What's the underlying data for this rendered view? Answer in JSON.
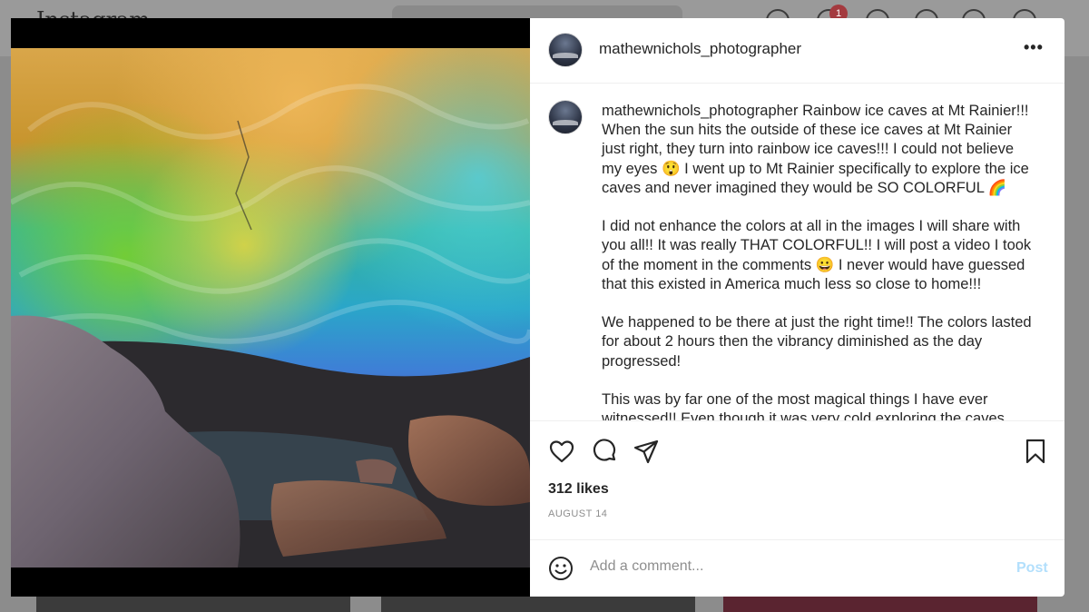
{
  "background": {
    "logo": "Instagram",
    "notification_count": "1"
  },
  "post": {
    "username": "mathewnichols_photographer",
    "more_label": "•••",
    "caption": {
      "line1": " Rainbow ice caves at Mt Rainier!!! When the sun hits the outside of these ice caves at Mt Rainier just right, they turn into rainbow ice caves!!! I could not believe my eyes ",
      "emoji1": "😲",
      "line1b": " I went up to Mt Rainier specifically to explore the ice caves and never imagined they would be SO COLORFUL ",
      "emoji2": "🌈",
      "para2a": "I did not enhance the colors at all in the images I will share with you all!! It was really THAT COLORFUL!! I will post a video I took of the moment in the comments ",
      "emoji3": "😀",
      "para2b": " I never would have guessed that this existed in America much less so close to home!!!",
      "para3": "We happened to be there at just the right time!! The colors lasted for about 2 hours then the vibrancy diminished as the day progressed!",
      "para4": "This was by far one of the most magical things I have ever witnessed!! Even though it was very cold exploring the caves"
    },
    "likes": "312 likes",
    "date": "AUGUST 14",
    "comment_placeholder": "Add a comment...",
    "post_label": "Post",
    "icons": {
      "like": "heart-icon",
      "comment": "comment-icon",
      "share": "share-icon",
      "save": "bookmark-icon",
      "emoji": "emoji-icon"
    },
    "colors": {
      "post_button": "#b2dffc",
      "meta_text": "#8e8e8e"
    }
  }
}
